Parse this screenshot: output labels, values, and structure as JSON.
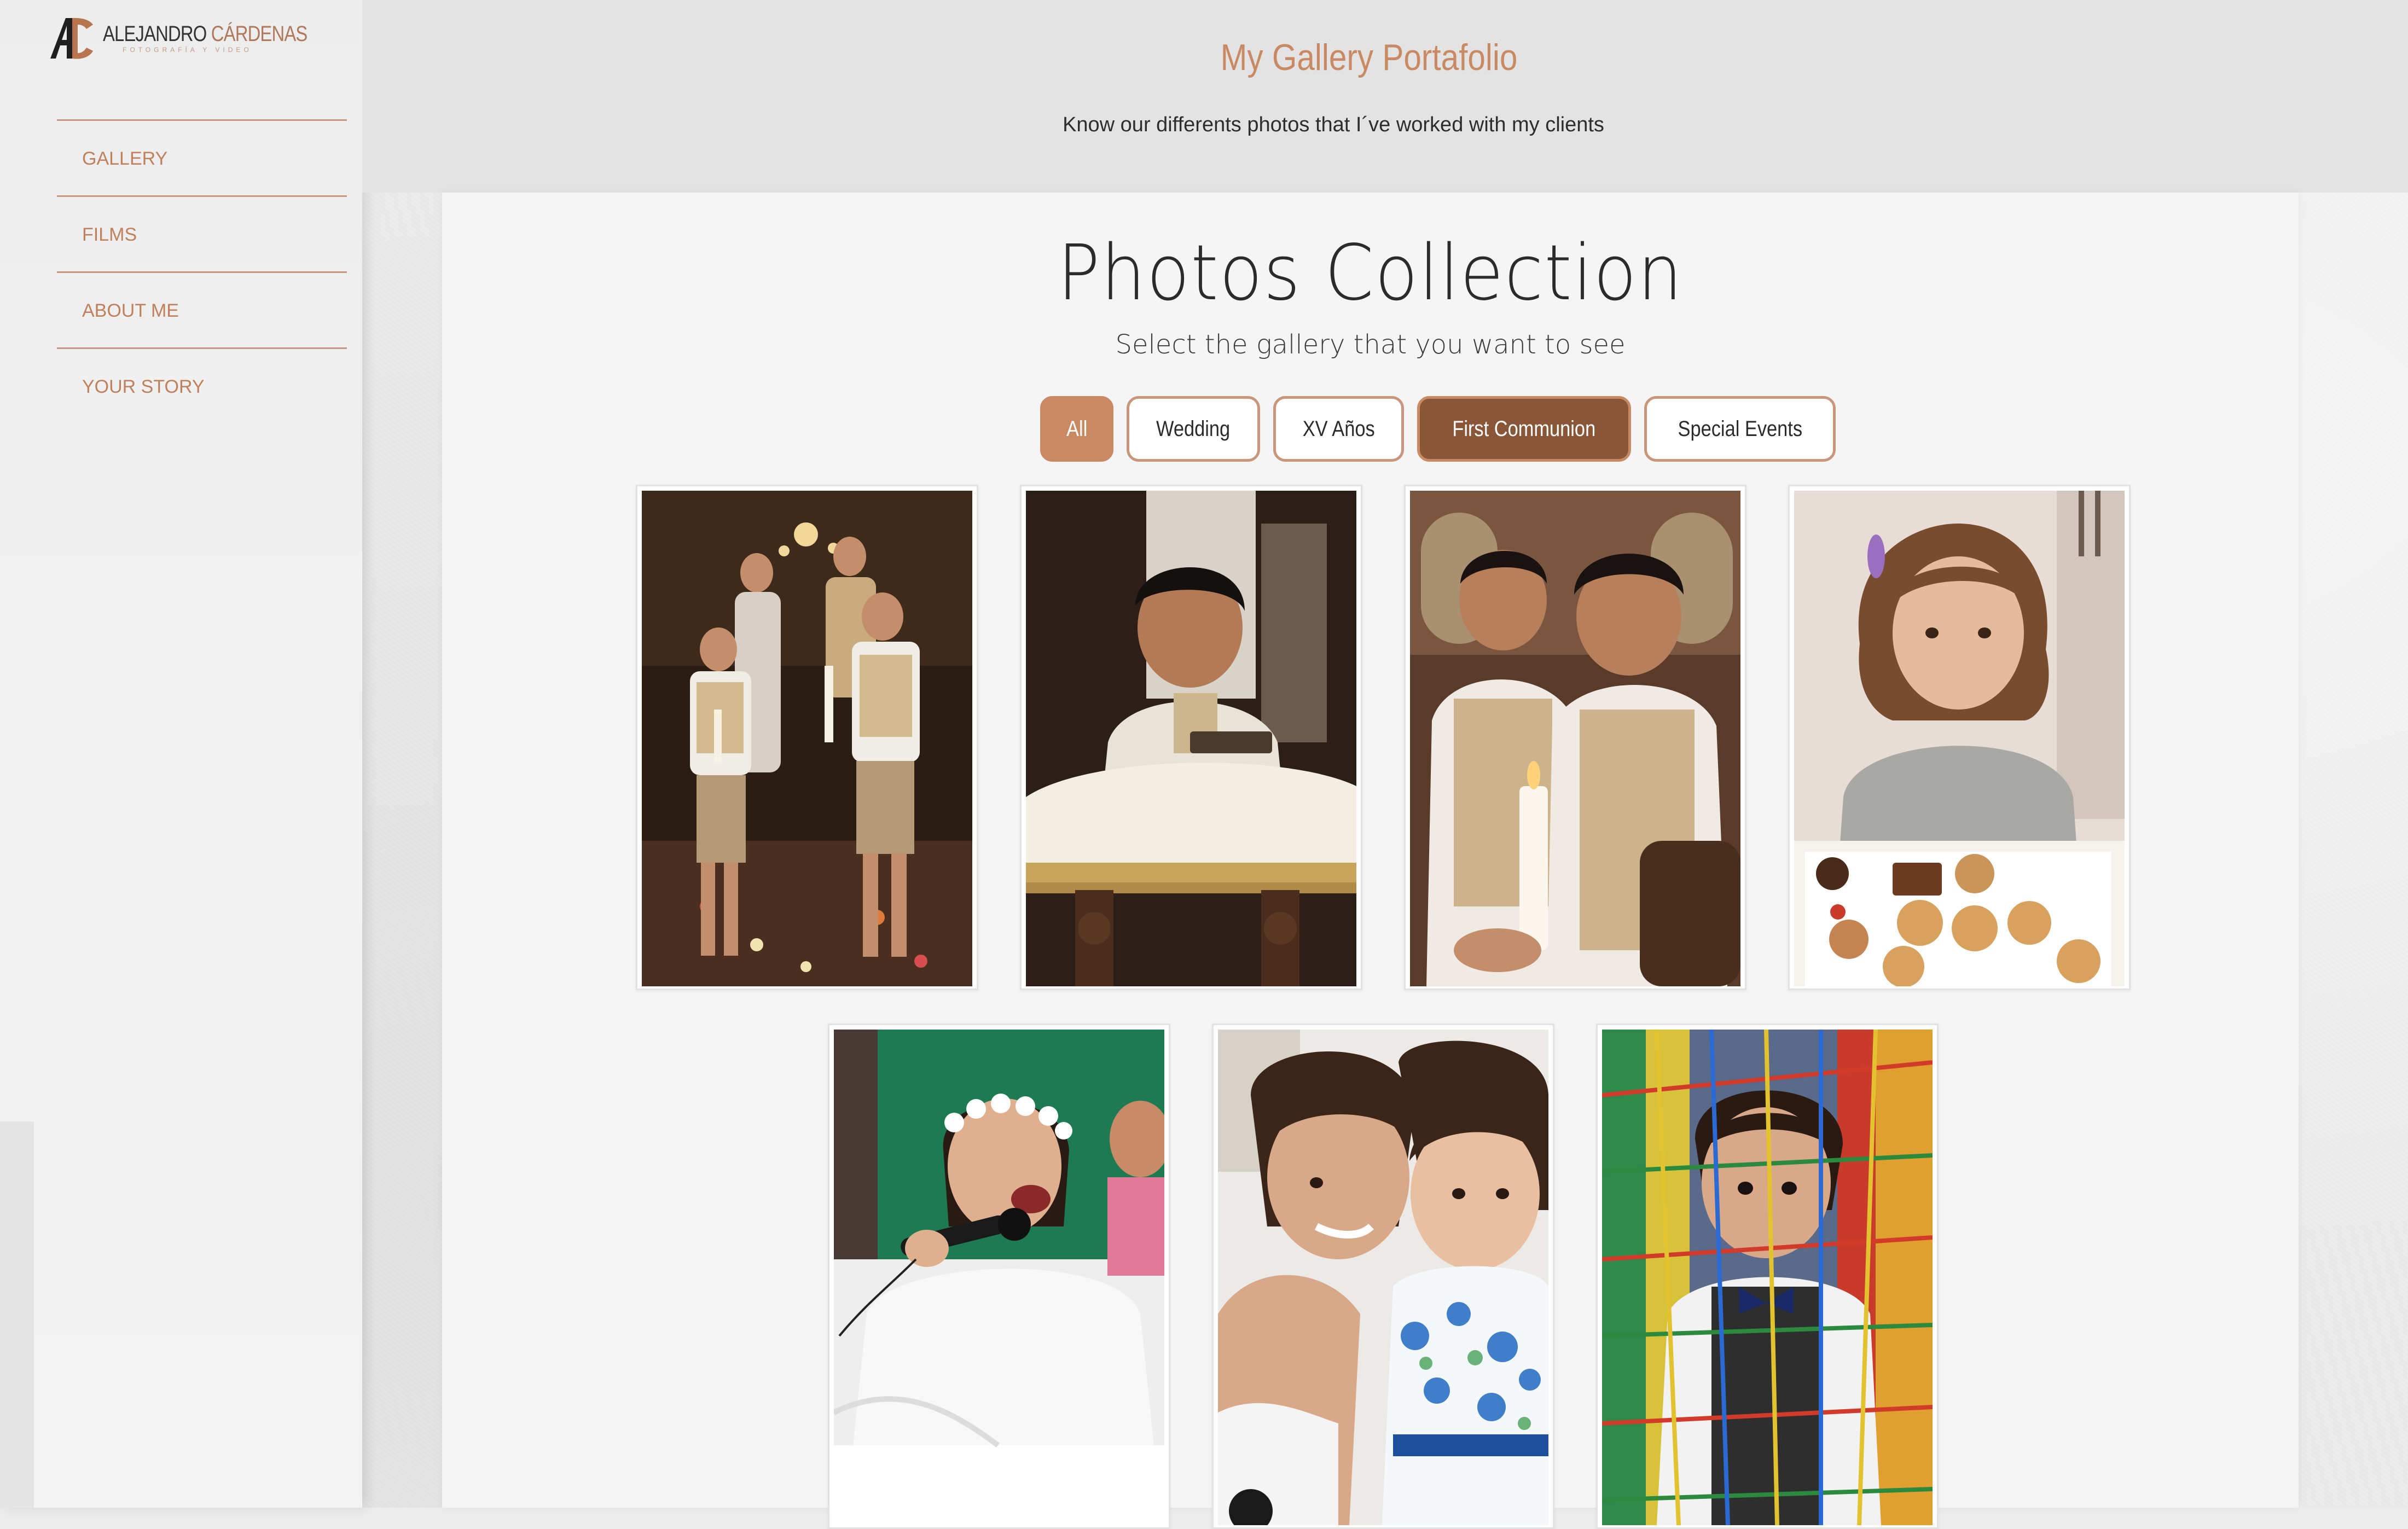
{
  "brand": {
    "name_first": "ALEJANDRO",
    "name_last": "CÁRDENAS",
    "tagline": "FOTOGRAFÍA Y VIDEO",
    "logo_letters": "AC"
  },
  "sidebar": {
    "items": [
      {
        "label": "GALLERY"
      },
      {
        "label": "FILMS"
      },
      {
        "label": "ABOUT ME"
      },
      {
        "label": "YOUR STORY"
      }
    ]
  },
  "header": {
    "title": "My Gallery Portafolio",
    "subtitle": "Know our differents photos that I´ve worked with my clients"
  },
  "main": {
    "title": "Photos Collection",
    "subtitle": "Select the gallery that you want to see",
    "filters": [
      {
        "label": "All",
        "state": "primary"
      },
      {
        "label": "Wedding",
        "state": "default"
      },
      {
        "label": "XV Años",
        "state": "default"
      },
      {
        "label": "First Communion",
        "state": "active"
      },
      {
        "label": "Special Events",
        "state": "default"
      }
    ],
    "photos": [
      {
        "subject": "two boys holding candles walking down aisle with parents"
      },
      {
        "subject": "boy praying at kneeler"
      },
      {
        "subject": "two boys seated in church with candle"
      },
      {
        "subject": "girl at table with cookies"
      },
      {
        "subject": "girl with flower crown singing into microphone"
      },
      {
        "subject": "two girls hugging"
      },
      {
        "subject": "boy behind colorful rope net"
      }
    ]
  },
  "colors": {
    "accent": "#c98a63",
    "accent_dark": "#8a5638",
    "nav_text": "#c0805c",
    "header_bg": "#e3e3e3",
    "panel_bg": "#f5f5f5"
  }
}
